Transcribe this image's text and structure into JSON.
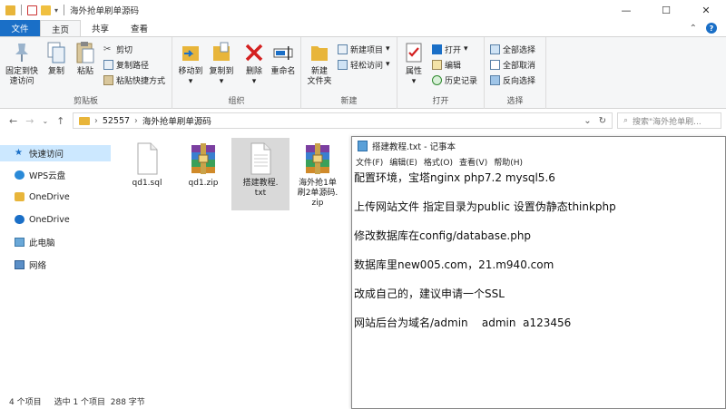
{
  "window": {
    "title": "海外抢单刷单源码",
    "controls": {
      "minimize": "—",
      "maximize": "☐",
      "close": "✕"
    }
  },
  "ribbon_tabs": [
    {
      "label": "文件"
    },
    {
      "label": "主页"
    },
    {
      "label": "共享"
    },
    {
      "label": "查看"
    }
  ],
  "ribbon": {
    "clipboard": {
      "label": "剪贴板",
      "pin": "固定到快\n速访问",
      "copy": "复制",
      "paste": "粘贴",
      "cut": "剪切",
      "copy_path": "复制路径",
      "paste_shortcut": "粘贴快捷方式"
    },
    "organize": {
      "label": "组织",
      "move_to": "移动到",
      "copy_to": "复制到",
      "delete": "删除",
      "rename": "重命名"
    },
    "new": {
      "label": "新建",
      "new_folder": "新建\n文件夹",
      "new_item": "新建项目",
      "easy_access": "轻松访问"
    },
    "open": {
      "label": "打开",
      "properties": "属性",
      "open": "打开",
      "edit": "编辑",
      "history": "历史记录"
    },
    "select": {
      "label": "选择",
      "select_all": "全部选择",
      "select_none": "全部取消",
      "invert": "反向选择"
    }
  },
  "address": {
    "path_parts": [
      "52557",
      "海外抢单刷单源码"
    ],
    "search_placeholder": "搜索\"海外抢单刷..."
  },
  "nav_pane": [
    {
      "label": "快速访问",
      "icon": "star-icon"
    },
    {
      "label": "WPS云盘",
      "icon": "cloud-icon"
    },
    {
      "label": "OneDrive",
      "icon": "cloud-icon"
    },
    {
      "label": "OneDrive",
      "icon": "cloud-icon"
    },
    {
      "label": "此电脑",
      "icon": "computer-icon"
    },
    {
      "label": "网络",
      "icon": "network-icon"
    }
  ],
  "files": [
    {
      "name": "qd1.sql",
      "type": "doc"
    },
    {
      "name": "qd1.zip",
      "type": "archive"
    },
    {
      "name": "搭建教程.\ntxt",
      "type": "doc"
    },
    {
      "name": "海外抢1单\n刷2单源码.\nzip",
      "type": "archive"
    }
  ],
  "status": {
    "count": "4 个项目",
    "selection": "选中 1 个项目  288 字节"
  },
  "notepad": {
    "title": "搭建教程.txt - 记事本",
    "menu": [
      "文件(F)",
      "编辑(E)",
      "格式(O)",
      "查看(V)",
      "帮助(H)"
    ],
    "lines": [
      "配置环境，宝塔nginx  php7.2  mysql5.6",
      "上传网站文件  指定目录为public 设置伪静态thinkphp",
      "修改数据库在config/database.php",
      "数据库里new005.com，21.m940.com",
      "改成自己的，建议申请一个SSL",
      "网站后台为域名/admin    admin  a123456"
    ]
  },
  "colors": {
    "file_tab": "#1a6fc7",
    "nav_selected": "#cce8ff",
    "folder": "#e8b53a",
    "file_selected": "#d9d9d9"
  }
}
